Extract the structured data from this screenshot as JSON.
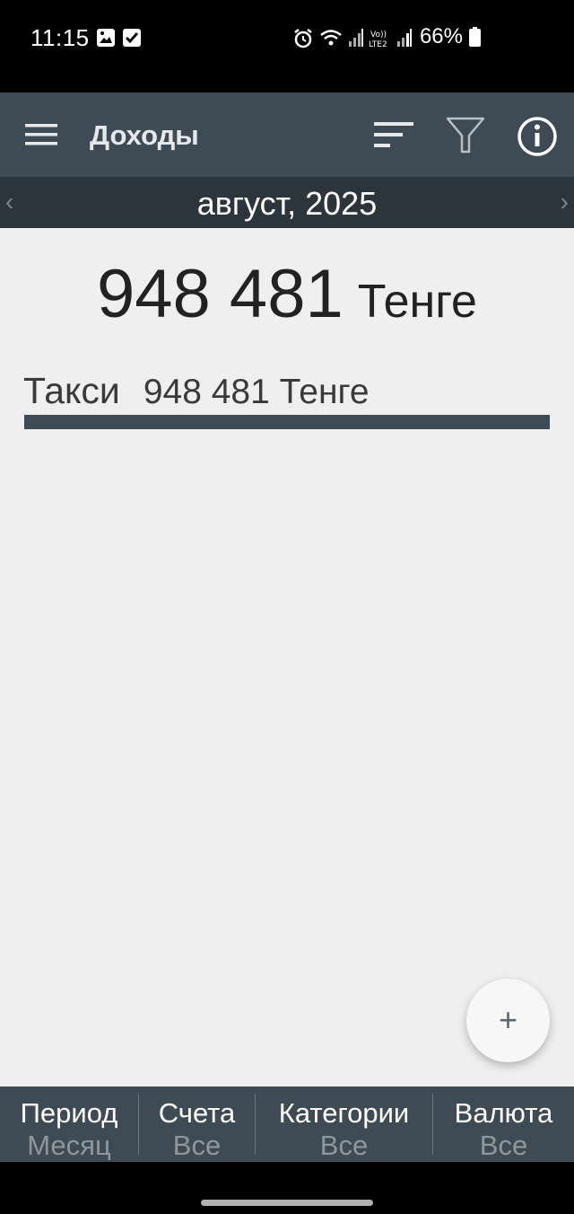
{
  "status_bar": {
    "time": "11:15",
    "battery": "66%",
    "icons": [
      "image-icon",
      "check-icon",
      "alarm-icon",
      "wifi-icon",
      "signal-icon",
      "volte-icon",
      "signal-icon",
      "battery-icon"
    ]
  },
  "app_bar": {
    "title": "Доходы",
    "icons": [
      "menu-icon",
      "sort-icon",
      "filter-icon",
      "info-icon"
    ]
  },
  "period": {
    "label": "август, 2025",
    "prev": "‹",
    "next": "›"
  },
  "summary": {
    "total_amount": "948 481",
    "currency": "Тенге"
  },
  "categories": [
    {
      "name": "Такси",
      "amount": "948 481 Тенге",
      "share": 1.0
    }
  ],
  "fab": {
    "label": "+"
  },
  "bottom_bar": {
    "items": [
      {
        "title": "Период",
        "value": "Месяц"
      },
      {
        "title": "Счета",
        "value": "Все"
      },
      {
        "title": "Категории",
        "value": "Все"
      },
      {
        "title": "Валюта",
        "value": "Все"
      }
    ]
  },
  "colors": {
    "app_bar": "#3e4b54",
    "period_bar": "#2c353c",
    "background": "#efefef",
    "category_bar": "#3e4b54"
  }
}
